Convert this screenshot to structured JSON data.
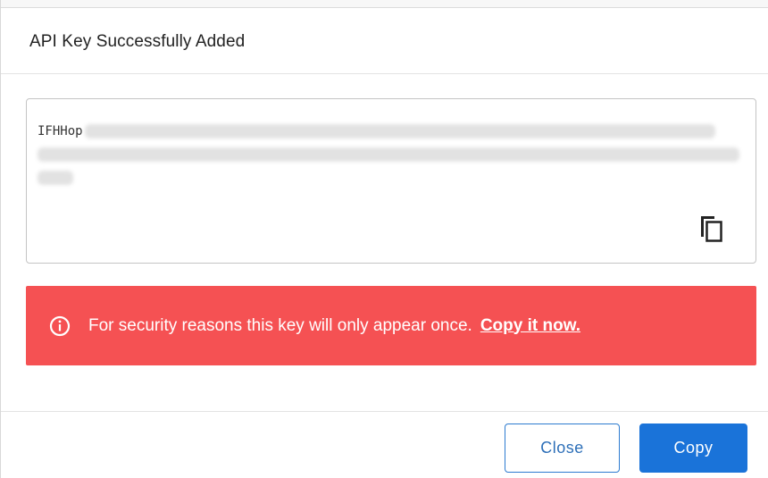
{
  "dialog": {
    "title": "API Key Successfully Added"
  },
  "api_key": {
    "visible_prefix": "IFHHop",
    "redacted": true
  },
  "copy_icon": {
    "icon": "copy-icon"
  },
  "alert": {
    "icon": "info-circle-icon",
    "message": "For security reasons this key will only appear once.",
    "link_text": "Copy it now.",
    "background_color": "#f55153"
  },
  "footer": {
    "close_label": "Close",
    "copy_label": "Copy",
    "primary_color": "#1a73d9"
  }
}
